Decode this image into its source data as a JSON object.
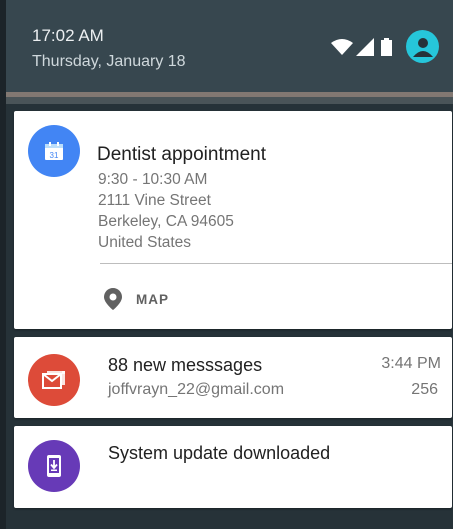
{
  "status_bar": {
    "time": "17:02 AM",
    "date": "Thursday, January 18",
    "icons": [
      "wifi-icon",
      "signal-icon",
      "battery-icon",
      "account-avatar-icon"
    ]
  },
  "colors": {
    "header_bg": "#37474f",
    "calendar": "#4285f4",
    "gmail": "#dd4b39",
    "system_update": "#673ab7",
    "avatar": "#26c6da"
  },
  "notifications": {
    "calendar": {
      "icon": "calendar-icon",
      "icon_text": "31",
      "title": "Dentist appointment",
      "time_range": "9:30 - 10:30 AM",
      "street": "2111 Vine Street",
      "city": "Berkeley, CA 94605",
      "country": "United States",
      "action": {
        "icon": "map-pin-icon",
        "label": "MAP"
      }
    },
    "gmail": {
      "icon": "gmail-icon",
      "title": "88 new messsages",
      "time": "3:44 PM",
      "account": "joffvrayn_22@gmail.com",
      "count": "256"
    },
    "system_update": {
      "icon": "phone-download-icon",
      "title": "System update downloaded"
    }
  }
}
